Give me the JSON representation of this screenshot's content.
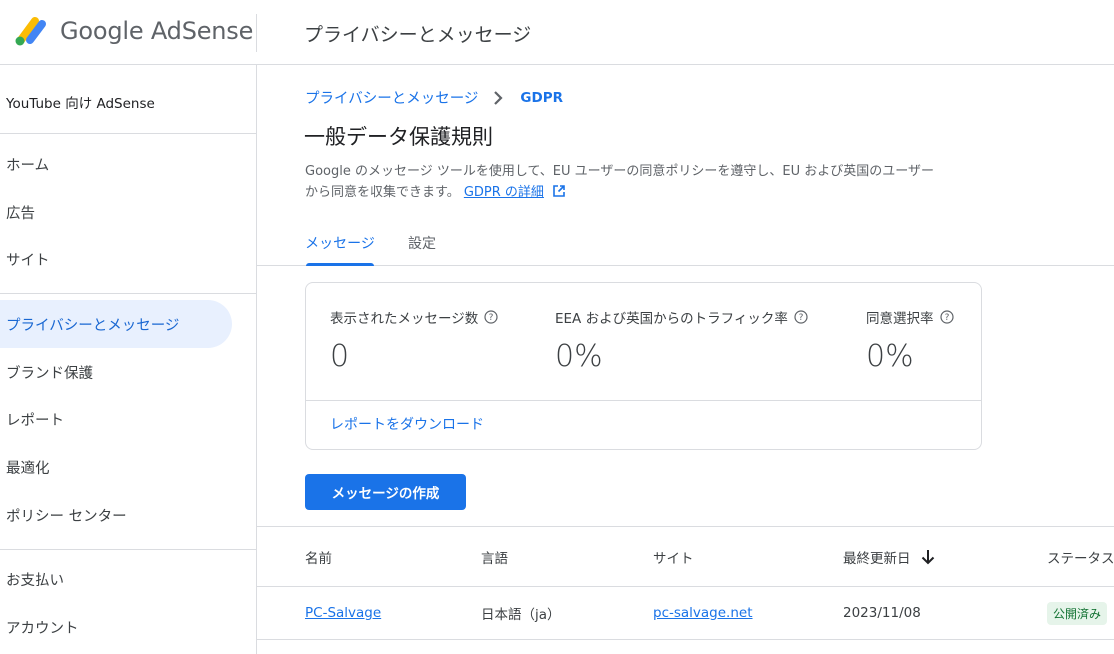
{
  "header": {
    "brand": "Google AdSense",
    "title": "プライバシーとメッセージ"
  },
  "sidebar": {
    "account": "YouTube 向け AdSense",
    "items": [
      {
        "label": "ホーム"
      },
      {
        "label": "広告"
      },
      {
        "label": "サイト"
      },
      {
        "label": "プライバシーとメッセージ",
        "active": true
      },
      {
        "label": "ブランド保護"
      },
      {
        "label": "レポート"
      },
      {
        "label": "最適化"
      },
      {
        "label": "ポリシー センター"
      },
      {
        "label": "お支払い"
      },
      {
        "label": "アカウント"
      }
    ]
  },
  "breadcrumb": {
    "parent": "プライバシーとメッセージ",
    "current": "GDPR"
  },
  "page": {
    "title": "一般データ保護規則",
    "description": "Google のメッセージ ツールを使用して、EU ユーザーの同意ポリシーを遵守し、EU および英国のユーザーから同意を収集できます。",
    "description_link": "GDPR の詳細"
  },
  "tabs": [
    {
      "label": "メッセージ",
      "active": true
    },
    {
      "label": "設定"
    }
  ],
  "stats": {
    "messages_shown": {
      "label": "表示されたメッセージ数",
      "value": "0"
    },
    "traffic_rate": {
      "label": "EEA および英国からのトラフィック率",
      "value": "0%"
    },
    "consent_rate": {
      "label": "同意選択率",
      "value": "0%"
    },
    "download_link": "レポートをダウンロード"
  },
  "create_button": "メッセージの作成",
  "table": {
    "columns": [
      "名前",
      "言語",
      "サイト",
      "最終更新日",
      "ステータス"
    ],
    "rows": [
      {
        "name": "PC-Salvage",
        "language": "日本語（ja）",
        "site": "pc-salvage.net",
        "updated": "2023/11/08",
        "status": "公開済み"
      }
    ]
  },
  "colors": {
    "accent": "#1a73e8",
    "active_bg": "#e8f0fe",
    "badge_bg": "#e6f4ea",
    "badge_text": "#137333"
  }
}
